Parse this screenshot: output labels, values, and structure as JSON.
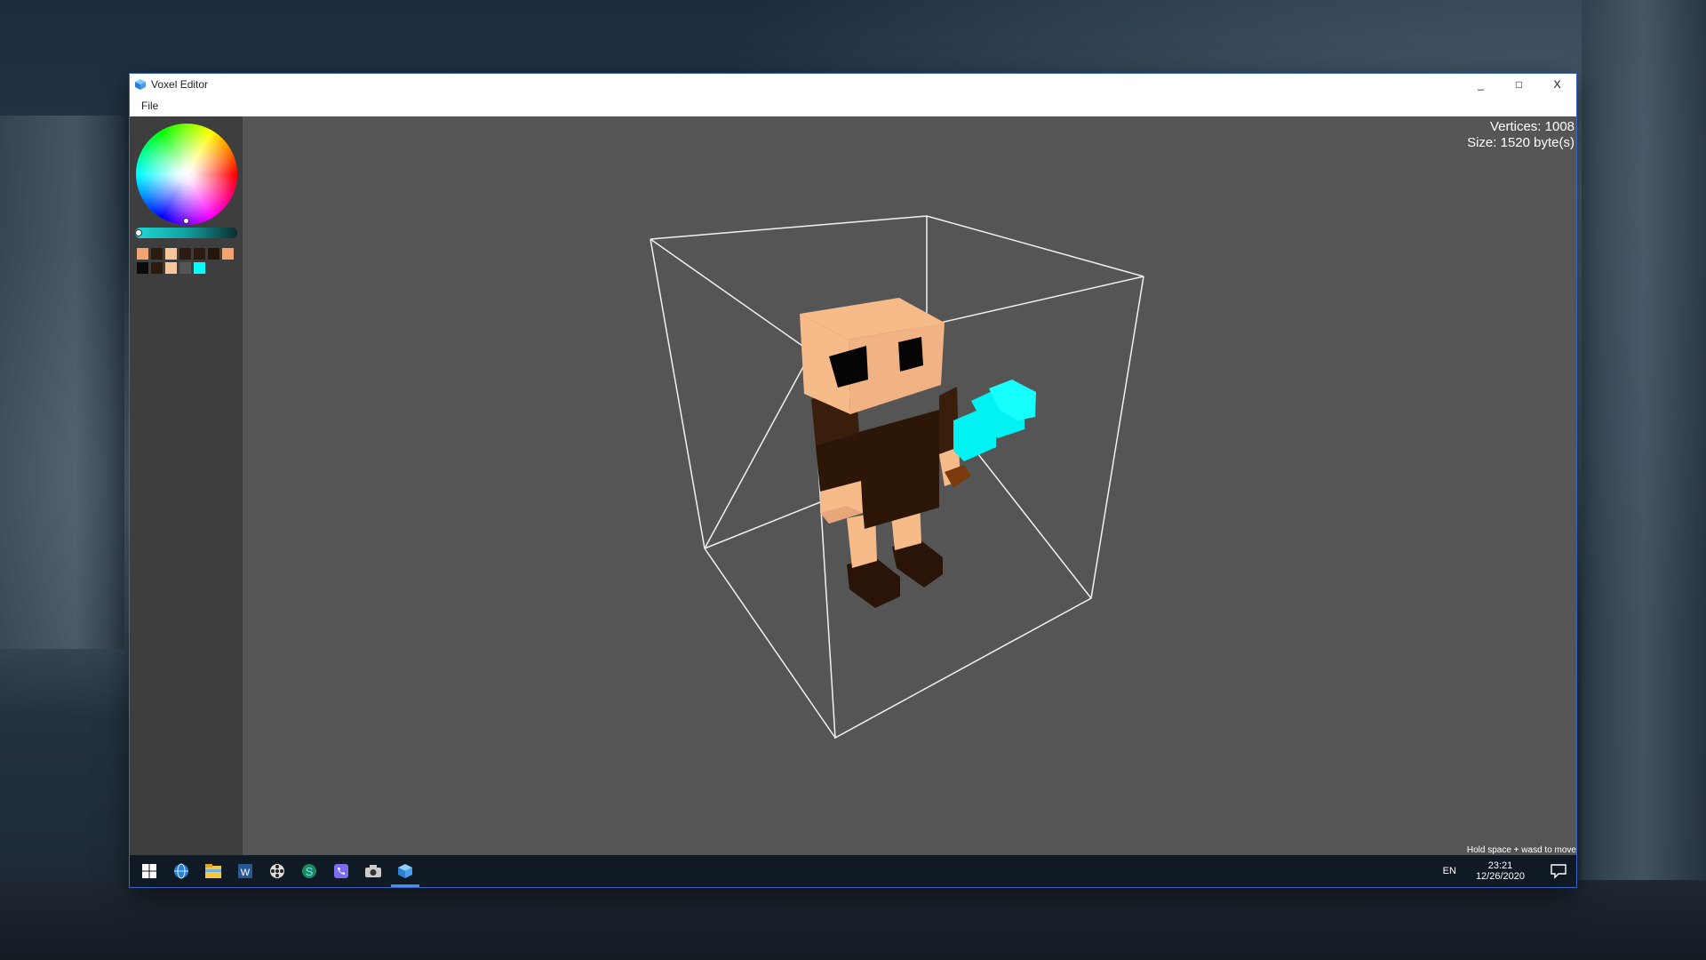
{
  "window": {
    "title": "Voxel Editor",
    "minimize": "_",
    "maximize": "□",
    "close": "X"
  },
  "menu": {
    "items": [
      "File"
    ]
  },
  "palette": {
    "colors": [
      "#f2a470",
      "#2b1a0e",
      "#f7c59a",
      "#2b1a0e",
      "#2b1a0e",
      "#24160b",
      "#f2a470",
      "#0b0b0b",
      "#2b1a0e",
      "#f7c59a",
      "#555555",
      "#00ffff",
      "#3e3e3e",
      "#3e3e3e"
    ]
  },
  "stats": {
    "vertices": "Vertices: 1008",
    "size": "Size: 1520 byte(s)"
  },
  "hint": "Hold space + wasd to move",
  "taskbar": {
    "icons": [
      "windows-start-icon",
      "globe-icon",
      "file-explorer-icon",
      "word-icon",
      "film-reel-icon",
      "s-app-icon",
      "phone-app-icon",
      "camera-icon",
      "voxel-editor-icon"
    ],
    "language": "EN",
    "time": "23:21",
    "date": "12/26/2020"
  },
  "colors": {
    "skin": "#f7bb8a",
    "skin_dark": "#e8a77a",
    "cloth": "#2b1608",
    "shoe": "#2a1408",
    "eye": "#050505",
    "sword": "#00f2f2",
    "handle": "#7a3a0e"
  }
}
